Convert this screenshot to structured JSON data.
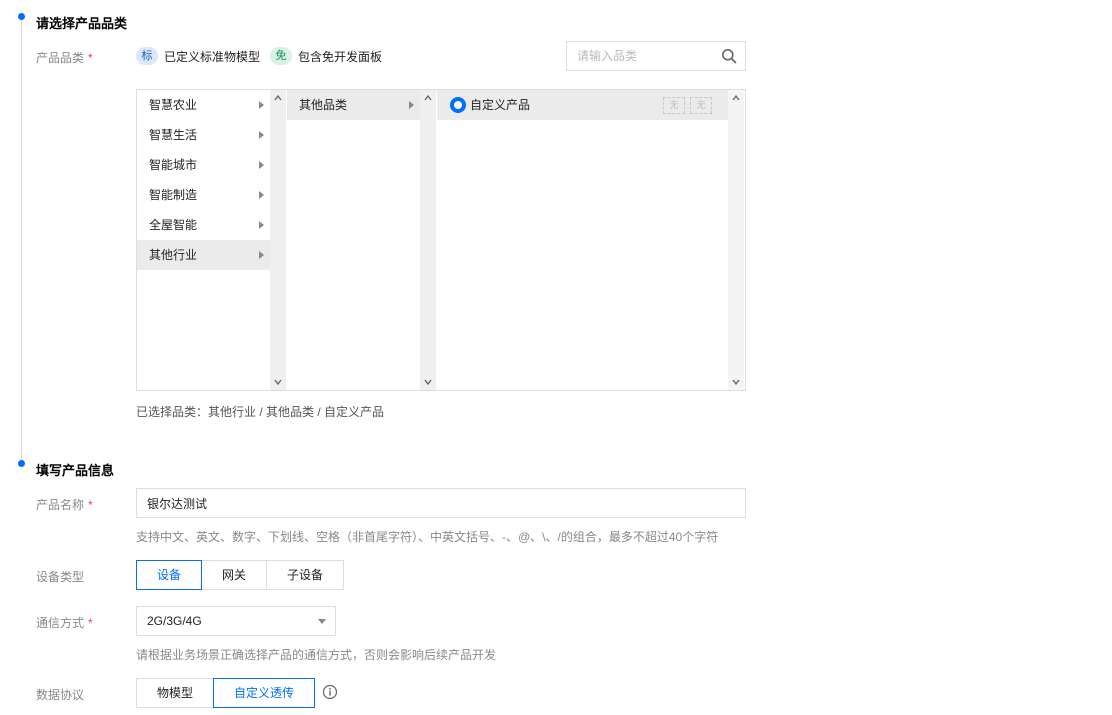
{
  "step1": {
    "title": "请选择产品品类",
    "category_label": "产品品类",
    "required_mark": "*",
    "legend": [
      {
        "badge": "标",
        "text": "已定义标准物模型"
      },
      {
        "badge": "免",
        "text": "包含免开发面板"
      }
    ],
    "search": {
      "placeholder": "请输入品类",
      "value": ""
    },
    "columns": {
      "industries": [
        {
          "label": "智慧农业",
          "active": false
        },
        {
          "label": "智慧生活",
          "active": false
        },
        {
          "label": "智能城市",
          "active": false
        },
        {
          "label": "智能制造",
          "active": false
        },
        {
          "label": "全屋智能",
          "active": false
        },
        {
          "label": "其他行业",
          "active": true
        }
      ],
      "categories": [
        {
          "label": "其他品类",
          "active": true
        }
      ],
      "products": [
        {
          "label": "自定义产品",
          "active": true,
          "tags": [
            "无",
            "无"
          ]
        }
      ]
    },
    "selected_prefix": "已选择品类：",
    "selected_path": "其他行业 / 其他品类 / 自定义产品"
  },
  "step2": {
    "title": "填写产品信息",
    "name": {
      "label": "产品名称",
      "value": "银尔达测试",
      "hint": "支持中文、英文、数字、下划线、空格（非首尾字符）、中英文括号、-、@、\\、/的组合，最多不超过40个字符"
    },
    "device_type": {
      "label": "设备类型",
      "options": [
        "设备",
        "网关",
        "子设备"
      ],
      "selected": 0
    },
    "comm": {
      "label": "通信方式",
      "value": "2G/3G/4G",
      "hint": "请根据业务场景正确选择产品的通信方式，否则会影响后续产品开发"
    },
    "protocol": {
      "label": "数据协议",
      "options": [
        "物模型",
        "自定义透传"
      ],
      "selected": 1
    }
  },
  "colors": {
    "accent": "#006eff",
    "required": "#e54545",
    "muted": "#888888",
    "border": "#dddddd"
  }
}
